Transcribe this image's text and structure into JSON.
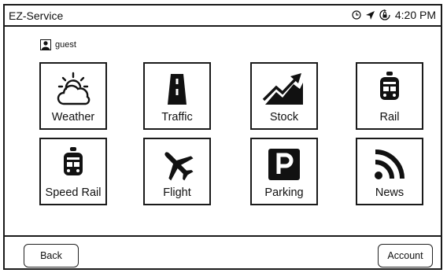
{
  "status_bar": {
    "app_title": "EZ-Service",
    "time": "4:20 PM"
  },
  "user": {
    "name": "guest"
  },
  "tiles": [
    {
      "label": "Weather",
      "icon": "weather-icon"
    },
    {
      "label": "Traffic",
      "icon": "road-icon"
    },
    {
      "label": "Stock",
      "icon": "stock-chart-icon"
    },
    {
      "label": "Rail",
      "icon": "train-icon"
    },
    {
      "label": "Speed Rail",
      "icon": "train-icon"
    },
    {
      "label": "Flight",
      "icon": "airplane-icon"
    },
    {
      "label": "Parking",
      "icon": "parking-icon"
    },
    {
      "label": "News",
      "icon": "rss-icon"
    }
  ],
  "footer": {
    "back_label": "Back",
    "account_label": "Account"
  }
}
